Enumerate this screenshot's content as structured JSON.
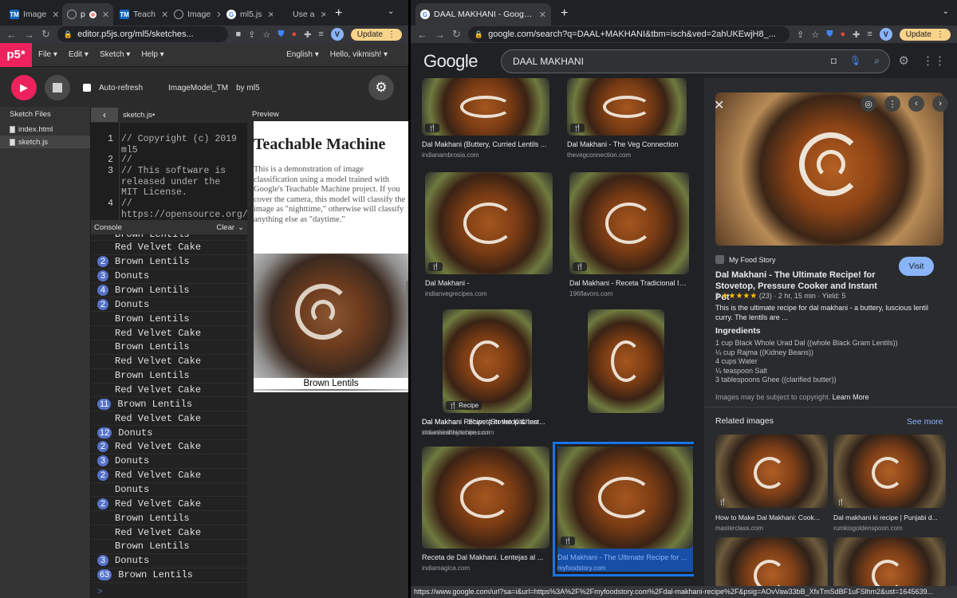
{
  "left_window": {
    "tabs": [
      {
        "title": "Image",
        "fav": "TM"
      },
      {
        "title": "p",
        "fav": "globe",
        "recording": true
      },
      {
        "title": "Teach",
        "fav": "TM"
      },
      {
        "title": "Image",
        "fav": "globe"
      },
      {
        "title": "ml5.js",
        "fav": "G"
      },
      {
        "title": "Use a",
        "fav": "apple"
      }
    ],
    "url": "editor.p5js.org/ml5/sketches...",
    "avatar": "V",
    "update_label": "Update"
  },
  "p5": {
    "logo": "p5*",
    "menu": [
      "File ▾",
      "Edit ▾",
      "Sketch ▾",
      "Help ▾"
    ],
    "language": "English ▾",
    "user": "Hello, vikmish! ▾",
    "auto_refresh": "Auto-refresh",
    "sketch_name": "ImageModel_TM",
    "by": "by ml5",
    "sketch_files_label": "Sketch Files",
    "files": [
      "index.html",
      "sketch.js"
    ],
    "active_file": "sketch.js",
    "editor_tab": "sketch.js•",
    "code_lines": [
      {
        "n": "1",
        "text": "// Copyright (c) 2019 ml5"
      },
      {
        "n": "2",
        "text": "//"
      },
      {
        "n": "3",
        "text": "// This software is released under the MIT License."
      },
      {
        "n": "4",
        "text": "// https://opensource.org/"
      }
    ],
    "console_label": "Console",
    "clear_label": "Clear",
    "console_rows": [
      {
        "badge": "",
        "text": "Brown Lentils"
      },
      {
        "badge": "",
        "text": "Red Velvet Cake"
      },
      {
        "badge": "2",
        "text": "Brown Lentils"
      },
      {
        "badge": "3",
        "text": "Donuts"
      },
      {
        "badge": "4",
        "text": "Brown Lentils"
      },
      {
        "badge": "2",
        "text": "Donuts"
      },
      {
        "badge": "",
        "text": "Brown Lentils"
      },
      {
        "badge": "",
        "text": "Red Velvet Cake"
      },
      {
        "badge": "",
        "text": "Brown Lentils"
      },
      {
        "badge": "",
        "text": "Red Velvet Cake"
      },
      {
        "badge": "",
        "text": "Brown Lentils"
      },
      {
        "badge": "",
        "text": "Red Velvet Cake"
      },
      {
        "badge": "11",
        "text": "Brown Lentils"
      },
      {
        "badge": "",
        "text": "Red Velvet Cake"
      },
      {
        "badge": "12",
        "text": "Donuts"
      },
      {
        "badge": "2",
        "text": "Red Velvet Cake"
      },
      {
        "badge": "3",
        "text": "Donuts"
      },
      {
        "badge": "2",
        "text": "Red Velvet Cake"
      },
      {
        "badge": "",
        "text": "Donuts"
      },
      {
        "badge": "2",
        "text": "Red Velvet Cake"
      },
      {
        "badge": "",
        "text": "Brown Lentils"
      },
      {
        "badge": "",
        "text": "Red Velvet Cake"
      },
      {
        "badge": "",
        "text": "Brown Lentils"
      },
      {
        "badge": "3",
        "text": "Donuts"
      },
      {
        "badge": "63",
        "text": "Brown Lentils"
      }
    ],
    "console_prompt": ">",
    "preview_label": "Preview",
    "preview_title": "Teachable Machine",
    "preview_text": "This is a demonstration of image classification using a model trained with Google's Teachable Machine project. If you cover the camera, this model will classify the image as \"nighttime,\" otherwise will classify anything else as \"daytime.\"",
    "prediction": "Brown Lentils"
  },
  "right_window": {
    "tab_title": "DAAL MAKHANI - Google Search",
    "url": "google.com/search?q=DAAL+MAKHANI&tbm=isch&ved=2ahUKEwjH8_...",
    "avatar": "V",
    "update_label": "Update"
  },
  "google": {
    "logo": "Google",
    "query": "DAAL MAKHANI",
    "results": [
      {
        "caption": "Dal Makhani (Buttery, Curried Lentils ...",
        "source": "indianambrosia.com",
        "label": "🍴"
      },
      {
        "caption": "Dal Makhani - The Veg Connection",
        "source": "thevegconnection.com",
        "label": "🍴"
      },
      {
        "caption": "Dal Makhani -",
        "source": "indianvegrecipes.com",
        "label": "🍴"
      },
      {
        "caption": "Dal Makhani - Receta Tradicional Ind...",
        "source": "196flavors.com",
        "label": "🍴"
      },
      {
        "caption": "Dal Makhani - Shweta in the Kitchen",
        "source": "shwetainthekitchen.com",
        "label": "🍴 Recipe"
      },
      {
        "caption": "Dal Makhani Recipe (Stovetop & Inst...",
        "source": "indianhealthyrecipes.com",
        "label": ""
      },
      {
        "caption": "Receta de Dal Makhani. Lentejas al ...",
        "source": "indiamagica.com",
        "label": ""
      },
      {
        "caption": "Dal Makhani - The Ultimate Recipe for ...",
        "source": "myfoodstory.com",
        "label": "🍴"
      }
    ],
    "panel": {
      "site": "My Food Story",
      "visit": "Visit",
      "title": "Dal Makhani - The Ultimate Recipe! for Stovetop, Pressure Cooker and Instant Pot",
      "rating_value": "5",
      "stars": "★★★★★",
      "rating_count": "(23)",
      "time": "· 2 hr, 15 min",
      "yield": "· Yield: 5",
      "description": "This is the ultimate recipe for dal makhani - a buttery, luscious lentil curry. The lentils are ...",
      "ingredients_heading": "Ingredients",
      "ingredients": [
        "1 cup Black Whole Urad Dal ((whole Black Gram Lentils))",
        "¼ cup Rajma ((Kidney Beans))",
        "4 cups Water",
        "¼ teaspoon Salt",
        "3 tablespoons Ghee ((clarified butter))"
      ],
      "copyright": "Images may be subject to copyright.",
      "learn_more": "Learn More",
      "related_heading": "Related images",
      "see_more": "See more",
      "related": [
        {
          "caption": "How to Make Dal Makhani: Cook...",
          "source": "masterclass.com"
        },
        {
          "caption": "Dal makhani ki recipe | Punjabi d...",
          "source": "rumkisgoldenspoon.com"
        },
        {
          "caption": "",
          "source": ""
        },
        {
          "caption": "",
          "source": ""
        }
      ]
    },
    "status_url": "https://www.google.com/url?sa=i&url=https%3A%2F%2Fmyfoodstory.com%2Fdal-makhani-recipe%2F&psig=AOvVaw33bB_XfxTmSdBF1uFSlhm2&ust=1645639..."
  }
}
